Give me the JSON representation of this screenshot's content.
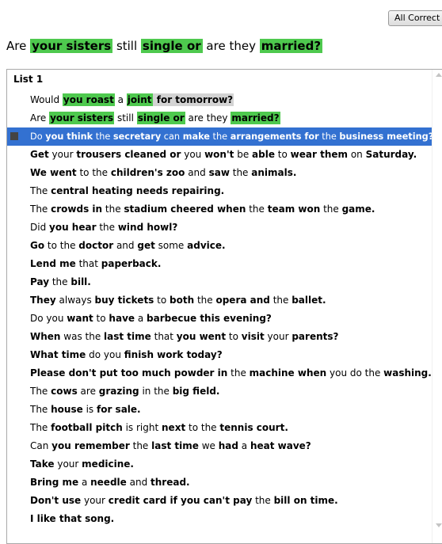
{
  "toolbar": {
    "all_correct_label": "All Correct"
  },
  "current_sentence": [
    {
      "t": "Are ",
      "s": "plain"
    },
    {
      "t": "your sisters",
      "s": "green"
    },
    {
      "t": " still ",
      "s": "plain"
    },
    {
      "t": "single or",
      "s": "green"
    },
    {
      "t": " are they ",
      "s": "plain"
    },
    {
      "t": "married?",
      "s": "green"
    }
  ],
  "list": {
    "title": "List 1",
    "items": [
      [
        {
          "t": "Would ",
          "s": "plain"
        },
        {
          "t": "you roast",
          "s": "green"
        },
        {
          "t": " a ",
          "s": "plain"
        },
        {
          "t": "joint",
          "s": "green"
        },
        {
          "t": " for tomorrow?",
          "s": "gray"
        }
      ],
      [
        {
          "t": "Are ",
          "s": "plain"
        },
        {
          "t": "your sisters",
          "s": "green"
        },
        {
          "t": " still ",
          "s": "plain"
        },
        {
          "t": "single or",
          "s": "green"
        },
        {
          "t": " are they ",
          "s": "plain"
        },
        {
          "t": "married?",
          "s": "green"
        }
      ],
      [
        {
          "t": "Do ",
          "s": "plain"
        },
        {
          "t": "you think",
          "s": "bold"
        },
        {
          "t": " the ",
          "s": "plain"
        },
        {
          "t": "secretary",
          "s": "bold"
        },
        {
          "t": " can ",
          "s": "plain"
        },
        {
          "t": "make",
          "s": "bold"
        },
        {
          "t": " the ",
          "s": "plain"
        },
        {
          "t": "arrangements for",
          "s": "bold"
        },
        {
          "t": " the ",
          "s": "plain"
        },
        {
          "t": "business meeting?",
          "s": "bold"
        }
      ],
      [
        {
          "t": "Get",
          "s": "bold"
        },
        {
          "t": " your ",
          "s": "plain"
        },
        {
          "t": "trousers cleaned or",
          "s": "bold"
        },
        {
          "t": " you ",
          "s": "plain"
        },
        {
          "t": "won't",
          "s": "bold"
        },
        {
          "t": " be ",
          "s": "plain"
        },
        {
          "t": "able",
          "s": "bold"
        },
        {
          "t": " to ",
          "s": "plain"
        },
        {
          "t": "wear them",
          "s": "bold"
        },
        {
          "t": " on ",
          "s": "plain"
        },
        {
          "t": "Saturday.",
          "s": "bold"
        }
      ],
      [
        {
          "t": "We went",
          "s": "bold"
        },
        {
          "t": " to the ",
          "s": "plain"
        },
        {
          "t": "children's zoo",
          "s": "bold"
        },
        {
          "t": " and ",
          "s": "plain"
        },
        {
          "t": "saw",
          "s": "bold"
        },
        {
          "t": " the ",
          "s": "plain"
        },
        {
          "t": "animals.",
          "s": "bold"
        }
      ],
      [
        {
          "t": "The ",
          "s": "plain"
        },
        {
          "t": "central heating needs repairing.",
          "s": "bold"
        }
      ],
      [
        {
          "t": "The ",
          "s": "plain"
        },
        {
          "t": "crowds in",
          "s": "bold"
        },
        {
          "t": " the ",
          "s": "plain"
        },
        {
          "t": "stadium cheered when",
          "s": "bold"
        },
        {
          "t": " the ",
          "s": "plain"
        },
        {
          "t": "team won",
          "s": "bold"
        },
        {
          "t": " the ",
          "s": "plain"
        },
        {
          "t": "game.",
          "s": "bold"
        }
      ],
      [
        {
          "t": "Did ",
          "s": "plain"
        },
        {
          "t": "you hear",
          "s": "bold"
        },
        {
          "t": " the ",
          "s": "plain"
        },
        {
          "t": "wind howl?",
          "s": "bold"
        }
      ],
      [
        {
          "t": "Go",
          "s": "bold"
        },
        {
          "t": " to the ",
          "s": "plain"
        },
        {
          "t": "doctor",
          "s": "bold"
        },
        {
          "t": " and ",
          "s": "plain"
        },
        {
          "t": "get",
          "s": "bold"
        },
        {
          "t": " some ",
          "s": "plain"
        },
        {
          "t": "advice.",
          "s": "bold"
        }
      ],
      [
        {
          "t": "Lend me",
          "s": "bold"
        },
        {
          "t": " that ",
          "s": "plain"
        },
        {
          "t": "paperback.",
          "s": "bold"
        }
      ],
      [
        {
          "t": "Pay",
          "s": "bold"
        },
        {
          "t": " the ",
          "s": "plain"
        },
        {
          "t": "bill.",
          "s": "bold"
        }
      ],
      [
        {
          "t": "They",
          "s": "bold"
        },
        {
          "t": " always ",
          "s": "plain"
        },
        {
          "t": "buy tickets",
          "s": "bold"
        },
        {
          "t": " to ",
          "s": "plain"
        },
        {
          "t": "both",
          "s": "bold"
        },
        {
          "t": " the ",
          "s": "plain"
        },
        {
          "t": "opera and",
          "s": "bold"
        },
        {
          "t": " the ",
          "s": "plain"
        },
        {
          "t": "ballet.",
          "s": "bold"
        }
      ],
      [
        {
          "t": "Do you ",
          "s": "plain"
        },
        {
          "t": "want",
          "s": "bold"
        },
        {
          "t": " to ",
          "s": "plain"
        },
        {
          "t": "have",
          "s": "bold"
        },
        {
          "t": " a ",
          "s": "plain"
        },
        {
          "t": "barbecue this evening?",
          "s": "bold"
        }
      ],
      [
        {
          "t": "When",
          "s": "bold"
        },
        {
          "t": " was the ",
          "s": "plain"
        },
        {
          "t": "last time",
          "s": "bold"
        },
        {
          "t": " that ",
          "s": "plain"
        },
        {
          "t": "you went",
          "s": "bold"
        },
        {
          "t": " to ",
          "s": "plain"
        },
        {
          "t": "visit",
          "s": "bold"
        },
        {
          "t": " your ",
          "s": "plain"
        },
        {
          "t": "parents?",
          "s": "bold"
        }
      ],
      [
        {
          "t": "What time",
          "s": "bold"
        },
        {
          "t": " do you ",
          "s": "plain"
        },
        {
          "t": "finish work today?",
          "s": "bold"
        }
      ],
      [
        {
          "t": "Please don't put too much powder in",
          "s": "bold"
        },
        {
          "t": " the ",
          "s": "plain"
        },
        {
          "t": "machine when",
          "s": "bold"
        },
        {
          "t": " you do the ",
          "s": "plain"
        },
        {
          "t": "washing.",
          "s": "bold"
        }
      ],
      [
        {
          "t": "The ",
          "s": "plain"
        },
        {
          "t": "cows",
          "s": "bold"
        },
        {
          "t": " are ",
          "s": "plain"
        },
        {
          "t": "grazing",
          "s": "bold"
        },
        {
          "t": " in the ",
          "s": "plain"
        },
        {
          "t": "big field.",
          "s": "bold"
        }
      ],
      [
        {
          "t": "The ",
          "s": "plain"
        },
        {
          "t": "house",
          "s": "bold"
        },
        {
          "t": " is ",
          "s": "plain"
        },
        {
          "t": "for sale.",
          "s": "bold"
        }
      ],
      [
        {
          "t": "The ",
          "s": "plain"
        },
        {
          "t": "football pitch",
          "s": "bold"
        },
        {
          "t": " is right ",
          "s": "plain"
        },
        {
          "t": "next",
          "s": "bold"
        },
        {
          "t": " to the ",
          "s": "plain"
        },
        {
          "t": "tennis court.",
          "s": "bold"
        }
      ],
      [
        {
          "t": "Can ",
          "s": "plain"
        },
        {
          "t": "you remember",
          "s": "bold"
        },
        {
          "t": " the ",
          "s": "plain"
        },
        {
          "t": "last time",
          "s": "bold"
        },
        {
          "t": " we ",
          "s": "plain"
        },
        {
          "t": "had",
          "s": "bold"
        },
        {
          "t": " a ",
          "s": "plain"
        },
        {
          "t": "heat wave?",
          "s": "bold"
        }
      ],
      [
        {
          "t": "Take",
          "s": "bold"
        },
        {
          "t": " your ",
          "s": "plain"
        },
        {
          "t": "medicine.",
          "s": "bold"
        }
      ],
      [
        {
          "t": "Bring me",
          "s": "bold"
        },
        {
          "t": " a ",
          "s": "plain"
        },
        {
          "t": "needle",
          "s": "bold"
        },
        {
          "t": " and ",
          "s": "plain"
        },
        {
          "t": "thread.",
          "s": "bold"
        }
      ],
      [
        {
          "t": "Don't use",
          "s": "bold"
        },
        {
          "t": " your ",
          "s": "plain"
        },
        {
          "t": "credit card if you can't pay",
          "s": "bold"
        },
        {
          "t": " the ",
          "s": "plain"
        },
        {
          "t": "bill on time.",
          "s": "bold"
        }
      ],
      [
        {
          "t": "I like that song.",
          "s": "bold"
        }
      ]
    ]
  },
  "selected_index": 2,
  "highlight_colors": {
    "green": "#4ec94e",
    "gray": "#d3d3d3",
    "selection": "#3371d1"
  }
}
